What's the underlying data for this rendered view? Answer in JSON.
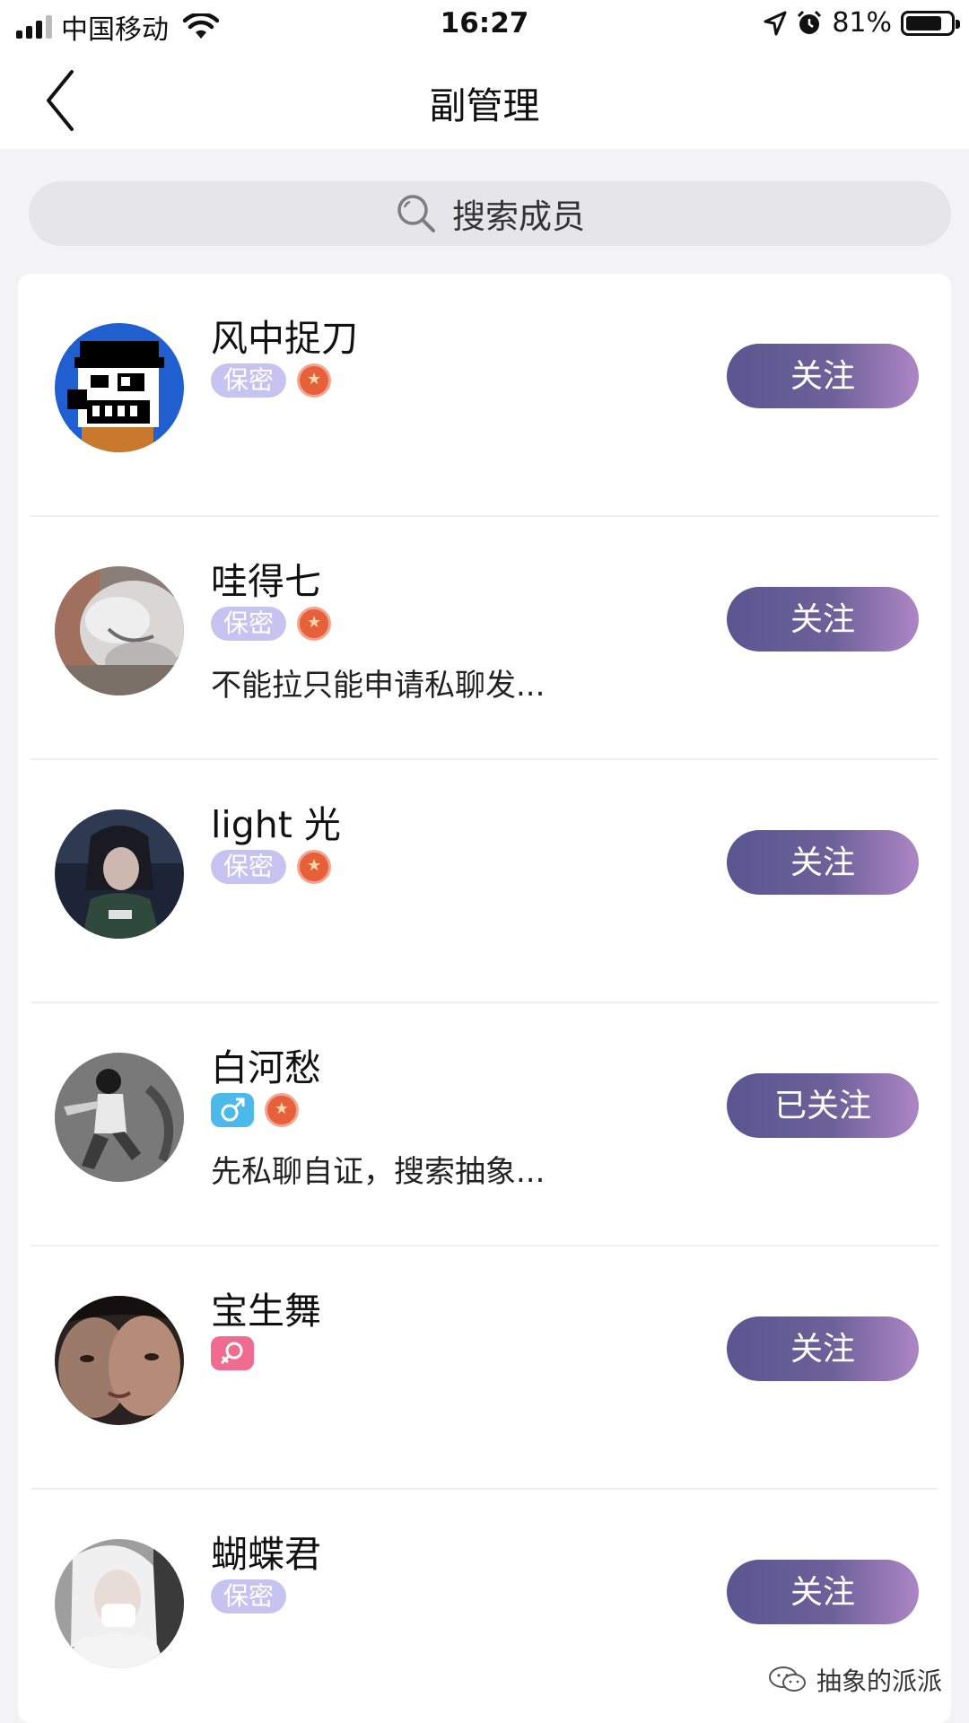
{
  "status_bar": {
    "carrier": "中国移动",
    "time": "16:27",
    "battery_percent": "81%",
    "battery_level": 0.81
  },
  "nav": {
    "title": "副管理",
    "back_icon": "chevron-left-icon"
  },
  "search": {
    "placeholder": "搜索成员",
    "icon": "search-icon"
  },
  "members": [
    {
      "name": "风中捉刀",
      "gender": "secret",
      "gender_label": "保密",
      "medal": true,
      "bio": "",
      "follow_label": "关注",
      "avatar": "pixel-character"
    },
    {
      "name": "哇得七",
      "gender": "secret",
      "gender_label": "保密",
      "medal": true,
      "bio": "不能拉只能申请私聊发...",
      "follow_label": "关注",
      "avatar": "cat-photo"
    },
    {
      "name": "light 光",
      "gender": "secret",
      "gender_label": "保密",
      "medal": true,
      "bio": "",
      "follow_label": "关注",
      "avatar": "anime-girl"
    },
    {
      "name": "白河愁",
      "gender": "male",
      "gender_label": "",
      "medal": true,
      "bio": "先私聊自证，搜索抽象...",
      "follow_label": "已关注",
      "avatar": "bw-person"
    },
    {
      "name": "宝生舞",
      "gender": "female",
      "gender_label": "",
      "medal": false,
      "bio": "",
      "follow_label": "关注",
      "avatar": "two-faces"
    },
    {
      "name": "蝴蝶君",
      "gender": "secret",
      "gender_label": "保密",
      "medal": false,
      "bio": "",
      "follow_label": "关注",
      "avatar": "white-hair-person"
    }
  ],
  "watermark": {
    "text": "抽象的派派",
    "icon": "wechat-icon"
  },
  "colors": {
    "follow_gradient_start": "#5a5690",
    "follow_gradient_end": "#ad86c4",
    "secret_tag": "#c7c3f0",
    "male_tag": "#4bb9ea",
    "female_tag": "#ef6b8f",
    "medal": "#e5603b"
  }
}
